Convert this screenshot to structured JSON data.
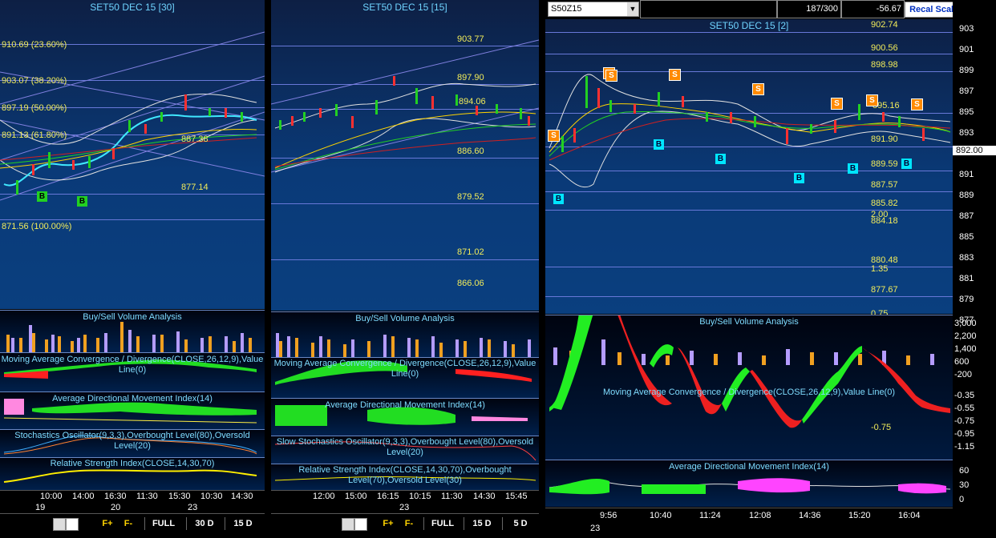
{
  "panels": [
    {
      "title": "SET50 DEC 15  [30]",
      "levels": [
        {
          "text": "910.69 (23.60%)"
        },
        {
          "text": "903.07 (38.20%)"
        },
        {
          "text": "897.19 (50.00%)"
        },
        {
          "text": "891.13 (61.80%)"
        },
        {
          "text": "887.38"
        },
        {
          "text": "877.14"
        },
        {
          "text": "871.56 (100.00%)"
        }
      ],
      "signals": [
        "B",
        "B"
      ],
      "indicators": {
        "volume": "Buy/Sell Volume Analysis",
        "macd": "Moving Average Convergence / Divergence(CLOSE,26,12,9),Value Line(0)",
        "adx": "Average Directional Movement Index(14)",
        "stoch": "Stochastics Oscillator(9,3,3),Overbought Level(80),Oversold Level(20)",
        "rsi": "Relative Strength Index(CLOSE,14,30,70)"
      },
      "time_ticks": [
        "10:00",
        "14:00",
        "16:30",
        "11:30",
        "15:30",
        "10:30",
        "14:30"
      ],
      "date_ticks": [
        "19",
        "20",
        "23"
      ],
      "toolbar": {
        "fplus": "F+",
        "fminus": "F-",
        "full": "FULL",
        "b1": "30 D",
        "b2": "15 D"
      }
    },
    {
      "title": "SET50 DEC 15  [15]",
      "levels": [
        {
          "text": "903.77"
        },
        {
          "text": "897.90"
        },
        {
          "text": "894.06"
        },
        {
          "text": "886.60"
        },
        {
          "text": "879.52"
        },
        {
          "text": "871.02"
        },
        {
          "text": "866.06"
        }
      ],
      "indicators": {
        "volume": "Buy/Sell Volume Analysis",
        "macd": "Moving Average Convergence / Divergence(CLOSE,26,12,9),Value Line(0)",
        "adx": "Average Directional Movement Index(14)",
        "stoch": "Slow Stochastics Oscillator(9,3,3),Overbought Level(80),Oversold Level(20)",
        "rsi": "Relative Strength Index(CLOSE,14,30,70),Overbought Level(70),Oversold Level(30)"
      },
      "time_ticks": [
        "12:00",
        "15:00",
        "16:15",
        "10:15",
        "11:30",
        "14:30",
        "15:45"
      ],
      "date_ticks": [
        "23"
      ],
      "toolbar": {
        "fplus": "F+",
        "fminus": "F-",
        "full": "FULL",
        "b1": "15 D",
        "b2": "5 D"
      }
    },
    {
      "symbol": "S50Z15",
      "counter": "187/300",
      "change": "-56.67",
      "recal_button": "Recal Scale-Linear",
      "title": "SET50 DEC 15  [2]",
      "levels": [
        {
          "text": "902.74"
        },
        {
          "text": "900.56"
        },
        {
          "text": "898.98"
        },
        {
          "text": "895.16"
        },
        {
          "text": "891.90"
        },
        {
          "text": "889.59"
        },
        {
          "text": "887.57"
        },
        {
          "text": "885.82"
        },
        {
          "text": "884.18"
        },
        {
          "text": "2.00"
        },
        {
          "text": "880.48"
        },
        {
          "text": "1.35"
        },
        {
          "text": "877.67"
        },
        {
          "text": "0.75"
        },
        {
          "text": "-0.75"
        }
      ],
      "last_price": "892.00",
      "price_axis": [
        "903",
        "901",
        "899",
        "897",
        "895",
        "893",
        "891",
        "889",
        "887",
        "885",
        "883",
        "881",
        "879",
        "877"
      ],
      "volume_axis": [
        "3,000",
        "2,200",
        "1,400",
        "600",
        "-200"
      ],
      "macd_axis": [
        "-0.35",
        "-0.55",
        "-0.75",
        "-0.95",
        "-1.15"
      ],
      "adx_axis": [
        "60",
        "30",
        "0"
      ],
      "signals_buy": [
        "B",
        "B",
        "B",
        "B",
        "B",
        "B"
      ],
      "signals_sell": [
        "S",
        "S",
        "S",
        "S",
        "S",
        "S",
        "S",
        "S"
      ],
      "indicators": {
        "volume": "Buy/Sell Volume Analysis",
        "macd": "Moving Average Convergence / Divergence(CLOSE,26,12,9),Value Line(0)",
        "adx": "Average Directional Movement Index(14)"
      },
      "time_ticks": [
        "9:56",
        "10:40",
        "11:24",
        "12:08",
        "14:36",
        "15:20",
        "16:04"
      ],
      "date_ticks": [
        "23"
      ]
    }
  ],
  "colors": {
    "level_text": "#f2ec5a",
    "title_text": "#6fd4ff",
    "up": "#22ff22",
    "down": "#ff2020",
    "accent": "#ffd400"
  }
}
